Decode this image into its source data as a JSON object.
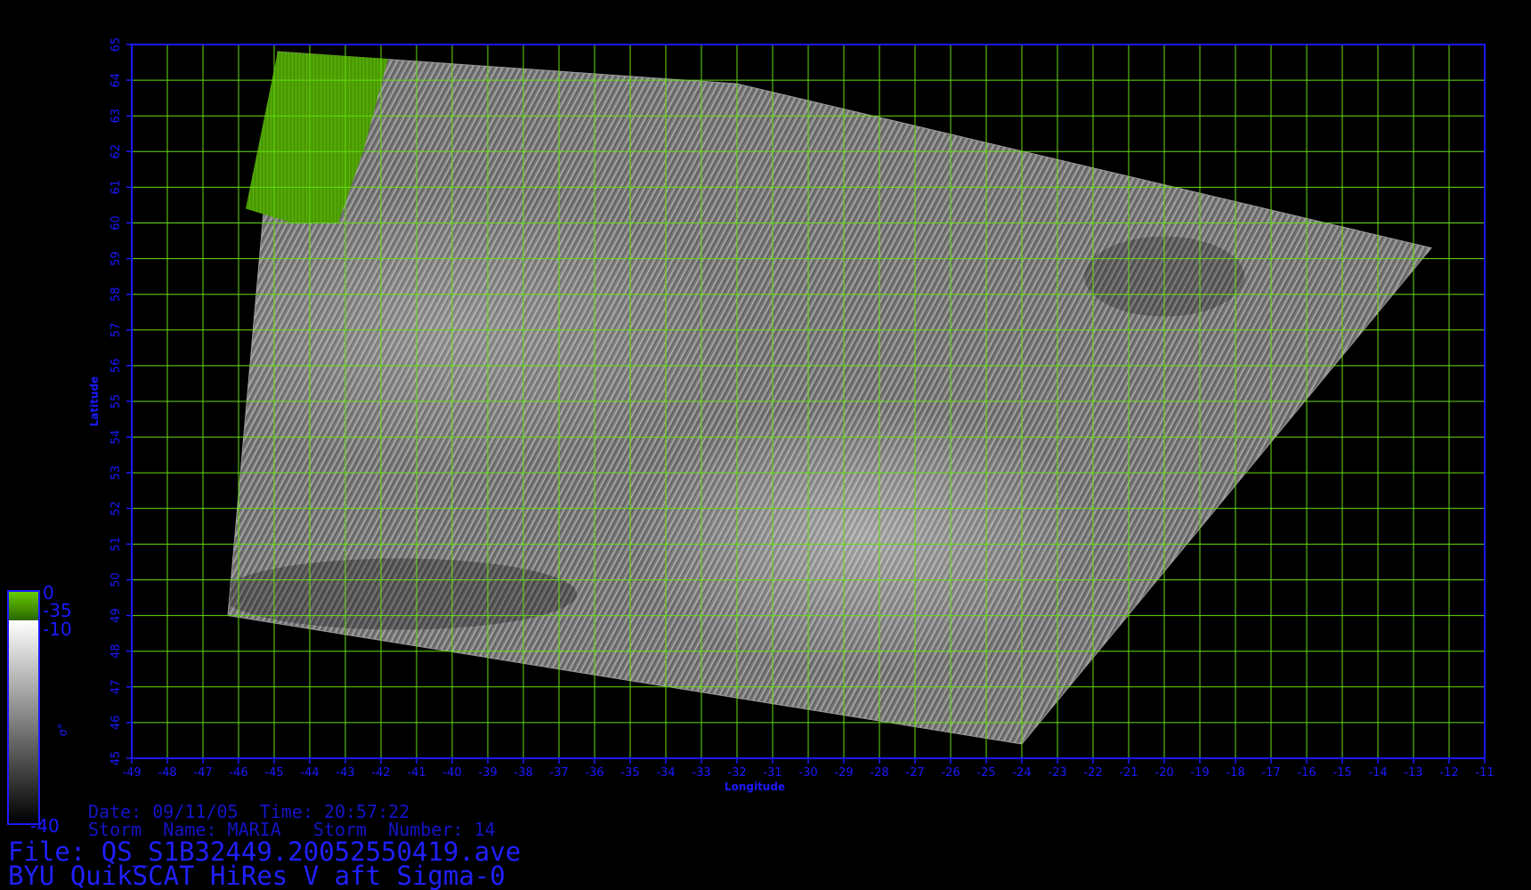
{
  "map": {
    "axis_x": {
      "label": "Longitude",
      "ticks": [
        "-49",
        "-48",
        "-47",
        "-46",
        "-45",
        "-44",
        "-43",
        "-42",
        "-41",
        "-40",
        "-39",
        "-38",
        "-37",
        "-36",
        "-35",
        "-34",
        "-33",
        "-32",
        "-31",
        "-30",
        "-29",
        "-28",
        "-27",
        "-26",
        "-25",
        "-24",
        "-23",
        "-22",
        "-21",
        "-20",
        "-19",
        "-18",
        "-17",
        "-16",
        "-15",
        "-14",
        "-13",
        "-12",
        "-11"
      ],
      "range": [
        -49,
        -11
      ]
    },
    "axis_y": {
      "label": "Latitude",
      "ticks": [
        "45",
        "46",
        "47",
        "48",
        "49",
        "50",
        "51",
        "52",
        "53",
        "54",
        "55",
        "56",
        "57",
        "58",
        "59",
        "60",
        "61",
        "62",
        "63",
        "64",
        "65"
      ],
      "range": [
        45,
        65
      ]
    },
    "grid": true,
    "colors": {
      "grid": "#66dd11",
      "axis": "#1a1aff",
      "land": "#4d9900",
      "swath": "#8a8a8a"
    },
    "swath_corners_lonlat": [
      [
        -46.3,
        49.0
      ],
      [
        -44.9,
        64.8
      ],
      [
        -32.0,
        63.9
      ],
      [
        -12.5,
        59.3
      ],
      [
        -24.0,
        45.4
      ]
    ],
    "land_region_lonlat": [
      [
        -44.9,
        64.8
      ],
      [
        -41.8,
        64.6
      ],
      [
        -42.5,
        62.0
      ],
      [
        -43.2,
        60.0
      ],
      [
        -44.5,
        60.0
      ],
      [
        -45.8,
        60.4
      ]
    ]
  },
  "colorbar": {
    "symbol": "σ°",
    "labels": [
      "0",
      "-35",
      "-10",
      "-40"
    ]
  },
  "info": {
    "line1": "Date: 09/11/05  Time: 20:57:22",
    "line2": "Storm  Name: MARIA   Storm  Number: 14",
    "file": "File: QS_S1B32449.20052550419.ave",
    "product": "BYU QuikSCAT HiRes V aft Sigma-0"
  }
}
